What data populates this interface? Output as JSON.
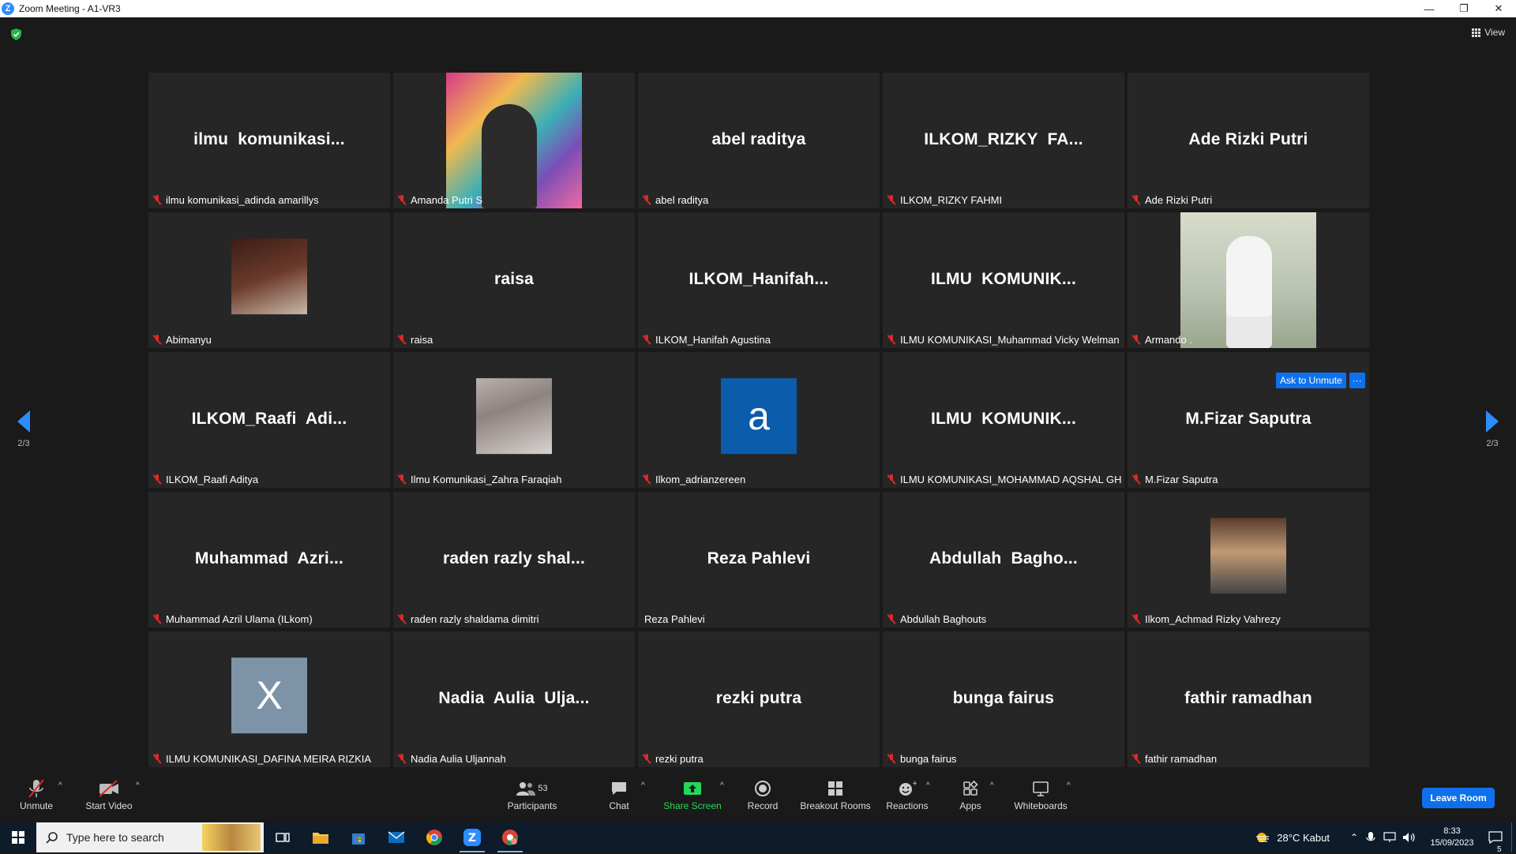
{
  "window": {
    "title": "Zoom Meeting - A1-VR3",
    "app_letter": "Z"
  },
  "header": {
    "view_label": "View"
  },
  "pagination": {
    "left": "2/3",
    "right": "2/3"
  },
  "tiles": [
    {
      "big": "ilmu  komunikasi...",
      "caption": "ilmu komunikasi_adinda amarillys",
      "muted": true,
      "media": "none"
    },
    {
      "big": "",
      "caption": "Amanda Putri S",
      "muted": true,
      "media": "photo-amanda"
    },
    {
      "big": "abel raditya",
      "caption": "abel raditya",
      "muted": true,
      "media": "none"
    },
    {
      "big": "ILKOM_RIZKY  FA...",
      "caption": "ILKOM_RIZKY FAHMI",
      "muted": true,
      "media": "none"
    },
    {
      "big": "Ade Rizki Putri",
      "caption": "Ade Rizki Putri",
      "muted": true,
      "media": "none"
    },
    {
      "big": "",
      "caption": "Abimanyu",
      "muted": true,
      "media": "photo-abim"
    },
    {
      "big": "raisa",
      "caption": "raisa",
      "muted": true,
      "media": "none"
    },
    {
      "big": "ILKOM_Hanifah...",
      "caption": "ILKOM_Hanifah Agustina",
      "muted": true,
      "media": "none"
    },
    {
      "big": "ILMU  KOMUNIK...",
      "caption": "ILMU KOMUNIKASI_Muhammad Vicky Welman",
      "muted": true,
      "media": "none"
    },
    {
      "big": "",
      "caption": "Armando .",
      "muted": true,
      "media": "photo-armando"
    },
    {
      "big": "ILKOM_Raafi  Adi...",
      "caption": "ILKOM_Raafi Aditya",
      "muted": true,
      "media": "none"
    },
    {
      "big": "",
      "caption": "Ilmu Komunikasi_Zahra Faraqiah",
      "muted": true,
      "media": "photo-zahra"
    },
    {
      "big": "",
      "caption": "Ilkom_adrianzereen",
      "muted": true,
      "media": "letter",
      "letter": "a",
      "letter_color": "#0b5cab"
    },
    {
      "big": "ILMU  KOMUNIK...",
      "caption": "ILMU KOMUNIKASI_MOHAMMAD AQSHAL GH...",
      "muted": true,
      "media": "none"
    },
    {
      "big": "M.Fizar Saputra",
      "caption": "M.Fizar Saputra",
      "muted": true,
      "media": "none"
    },
    {
      "big": "Muhammad  Azri...",
      "caption": "Muhammad Azril Ulama (ILkom)",
      "muted": true,
      "media": "none"
    },
    {
      "big": "raden razly shal...",
      "caption": "raden razly shaldama dimitri",
      "muted": true,
      "media": "none"
    },
    {
      "big": "Reza Pahlevi",
      "caption": "Reza Pahlevi",
      "muted": false,
      "media": "none"
    },
    {
      "big": "Abdullah  Bagho...",
      "caption": "Abdullah Baghouts",
      "muted": true,
      "media": "none"
    },
    {
      "big": "",
      "caption": "Ilkom_Achmad Rizky Vahrezy",
      "muted": true,
      "media": "photo-achmad"
    },
    {
      "big": "",
      "caption": "ILMU KOMUNIKASI_DAFINA MEIRA RIZKIA",
      "muted": true,
      "media": "letter",
      "letter": "X",
      "letter_color": "#7d93a8"
    },
    {
      "big": "Nadia  Aulia  Ulja...",
      "caption": "Nadia Aulia Uljannah",
      "muted": true,
      "media": "none"
    },
    {
      "big": "rezki putra",
      "caption": "rezki putra",
      "muted": true,
      "media": "none"
    },
    {
      "big": "bunga fairus",
      "caption": "bunga fairus",
      "muted": true,
      "media": "none"
    },
    {
      "big": "fathir ramadhan",
      "caption": "fathir ramadhan",
      "muted": true,
      "media": "none"
    }
  ],
  "hover_actions": {
    "ask_unmute": "Ask to Unmute",
    "more": "···"
  },
  "toolbar": {
    "unmute": "Unmute",
    "start_video": "Start Video",
    "participants": "Participants",
    "participants_count": "53",
    "chat": "Chat",
    "share_screen": "Share Screen",
    "record": "Record",
    "breakout_rooms": "Breakout Rooms",
    "reactions": "Reactions",
    "apps": "Apps",
    "whiteboards": "Whiteboards",
    "leave_room": "Leave Room",
    "share_color": "#23d959"
  },
  "taskbar": {
    "search_placeholder": "Type here to search",
    "weather": "28°C  Kabut",
    "time": "8:33",
    "date": "15/09/2023",
    "notifications": "5"
  },
  "colors": {
    "accent": "#0e71eb",
    "muted_red": "#e02828",
    "tile_bg": "#262626"
  }
}
